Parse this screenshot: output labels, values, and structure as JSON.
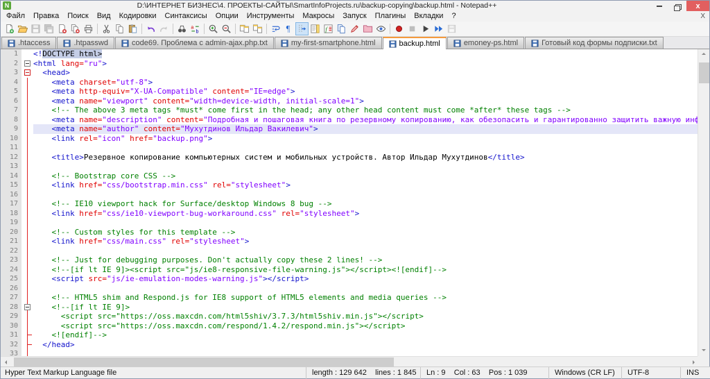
{
  "window": {
    "title": "D:\\ИНТЕРНЕТ БИЗНЕС\\4. ПРОЕКТЫ-САЙТЫ\\SmartInfoProjects.ru\\backup-copying\\backup.html - Notepad++",
    "app_icon": "N",
    "controls": {
      "minimize": "–",
      "restore": "",
      "close": "x"
    },
    "accent_close_color": "#e25f5f",
    "active_tab_accent": "#f59a3d"
  },
  "menu": {
    "items": [
      {
        "id": "file",
        "label": "Файл"
      },
      {
        "id": "edit",
        "label": "Правка"
      },
      {
        "id": "search",
        "label": "Поиск"
      },
      {
        "id": "view",
        "label": "Вид"
      },
      {
        "id": "encoding",
        "label": "Кодировки"
      },
      {
        "id": "language",
        "label": "Синтаксисы"
      },
      {
        "id": "settings",
        "label": "Опции"
      },
      {
        "id": "tools",
        "label": "Инструменты"
      },
      {
        "id": "macro",
        "label": "Макросы"
      },
      {
        "id": "run",
        "label": "Запуск"
      },
      {
        "id": "plugins",
        "label": "Плагины"
      },
      {
        "id": "tabs",
        "label": "Вкладки"
      },
      {
        "id": "help",
        "label": "?"
      }
    ],
    "close_label": "X"
  },
  "toolbar": {
    "items": [
      {
        "id": "new-file"
      },
      {
        "id": "open-file"
      },
      {
        "id": "save-file",
        "disabled": true
      },
      {
        "id": "save-all",
        "disabled": true
      },
      {
        "id": "close-file"
      },
      {
        "id": "close-all"
      },
      {
        "id": "print"
      },
      {
        "sep": true
      },
      {
        "id": "cut"
      },
      {
        "id": "copy"
      },
      {
        "id": "paste"
      },
      {
        "sep": true
      },
      {
        "id": "undo"
      },
      {
        "id": "redo",
        "disabled": true
      },
      {
        "sep": true
      },
      {
        "id": "find"
      },
      {
        "id": "replace"
      },
      {
        "sep": true
      },
      {
        "id": "zoom-in"
      },
      {
        "id": "zoom-out"
      },
      {
        "sep": true
      },
      {
        "id": "sync-vertical"
      },
      {
        "id": "sync-horizontal"
      },
      {
        "sep": true
      },
      {
        "id": "word-wrap"
      },
      {
        "id": "show-all-characters"
      },
      {
        "id": "show-indent-guide",
        "pressed": true
      },
      {
        "id": "doc-map"
      },
      {
        "id": "function-list"
      },
      {
        "id": "document-list"
      },
      {
        "id": "define-language"
      },
      {
        "id": "folder-as-workspace"
      },
      {
        "id": "monitoring"
      },
      {
        "sep": true
      },
      {
        "id": "macro-record"
      },
      {
        "id": "macro-stop",
        "disabled": true
      },
      {
        "id": "macro-play"
      },
      {
        "id": "macro-run-multiple"
      },
      {
        "id": "macro-save",
        "disabled": true
      }
    ]
  },
  "tabs": [
    {
      "label": ".htaccess",
      "active": false
    },
    {
      "label": ".htpasswd",
      "active": false
    },
    {
      "label": "code69. Проблема с admin-ajax.php.txt",
      "active": false
    },
    {
      "label": "my-first-smartphone.html",
      "active": false
    },
    {
      "label": "backup.html",
      "active": true
    },
    {
      "label": "emoney-ps.html",
      "active": false
    },
    {
      "label": "Готовый код формы подписки.txt",
      "active": false
    }
  ],
  "editor": {
    "current_line": 9,
    "lines": [
      {
        "n": 1,
        "fold": "",
        "seg": [
          [
            "t",
            "<!"
          ],
          [
            "d",
            "DOCTYPE html>"
          ]
        ]
      },
      {
        "n": 2,
        "fold": "box",
        "seg": [
          [
            "t",
            "<html "
          ],
          [
            "a",
            "lang="
          ],
          [
            "v",
            "\"ru\""
          ],
          [
            "t",
            ">"
          ]
        ]
      },
      {
        "n": 3,
        "fold": "box-active",
        "seg": [
          [
            "x",
            "  "
          ],
          [
            "t",
            "<head>"
          ]
        ]
      },
      {
        "n": 4,
        "fold": "line",
        "seg": [
          [
            "x",
            "    "
          ],
          [
            "t",
            "<meta "
          ],
          [
            "a",
            "charset="
          ],
          [
            "v",
            "\"utf-8\""
          ],
          [
            "t",
            ">"
          ]
        ]
      },
      {
        "n": 5,
        "fold": "line",
        "seg": [
          [
            "x",
            "    "
          ],
          [
            "t",
            "<meta "
          ],
          [
            "a",
            "http-equiv="
          ],
          [
            "v",
            "\"X-UA-Compatible\""
          ],
          [
            "x",
            " "
          ],
          [
            "a",
            "content="
          ],
          [
            "v",
            "\"IE=edge\""
          ],
          [
            "t",
            ">"
          ]
        ]
      },
      {
        "n": 6,
        "fold": "line",
        "seg": [
          [
            "x",
            "    "
          ],
          [
            "t",
            "<meta "
          ],
          [
            "a",
            "name="
          ],
          [
            "v",
            "\"viewport\""
          ],
          [
            "x",
            " "
          ],
          [
            "a",
            "content="
          ],
          [
            "v",
            "\"width=device-width, initial-scale=1\""
          ],
          [
            "t",
            ">"
          ]
        ]
      },
      {
        "n": 7,
        "fold": "line",
        "seg": [
          [
            "x",
            "    "
          ],
          [
            "c",
            "<!-- The above 3 meta tags *must* come first in the head; any other head content must come *after* these tags -->"
          ]
        ]
      },
      {
        "n": 8,
        "fold": "line",
        "seg": [
          [
            "x",
            "    "
          ],
          [
            "t",
            "<meta "
          ],
          [
            "a",
            "name="
          ],
          [
            "v",
            "\"description\""
          ],
          [
            "x",
            " "
          ],
          [
            "a",
            "content="
          ],
          [
            "v",
            "\"Подробная и пошаговая книга по резервному копированию, как обезопасить и гарантированно защитить важную информацию от внез"
          ]
        ]
      },
      {
        "n": 9,
        "fold": "line",
        "seg": [
          [
            "x",
            "    "
          ],
          [
            "t",
            "<meta "
          ],
          [
            "a",
            "name="
          ],
          [
            "v",
            "\"author\""
          ],
          [
            "x",
            " "
          ],
          [
            "a",
            "content="
          ],
          [
            "v",
            "\"Мухутдинов Ильдар Вакилевич\""
          ],
          [
            "t",
            ">"
          ]
        ]
      },
      {
        "n": 10,
        "fold": "line",
        "seg": [
          [
            "x",
            "    "
          ],
          [
            "t",
            "<link "
          ],
          [
            "a",
            "rel="
          ],
          [
            "v",
            "\"icon\""
          ],
          [
            "x",
            " "
          ],
          [
            "a",
            "href="
          ],
          [
            "v",
            "\"backup.png\""
          ],
          [
            "t",
            ">"
          ]
        ]
      },
      {
        "n": 11,
        "fold": "line",
        "seg": []
      },
      {
        "n": 12,
        "fold": "line",
        "seg": [
          [
            "x",
            "    "
          ],
          [
            "t",
            "<title>"
          ],
          [
            "x",
            "Резервное копирование компьютерных систем и мобильных устройств. Автор Ильдар Мухутдинов"
          ],
          [
            "t",
            "</title>"
          ]
        ]
      },
      {
        "n": 13,
        "fold": "line",
        "seg": []
      },
      {
        "n": 14,
        "fold": "line",
        "seg": [
          [
            "x",
            "    "
          ],
          [
            "c",
            "<!-- Bootstrap core CSS -->"
          ]
        ]
      },
      {
        "n": 15,
        "fold": "line",
        "seg": [
          [
            "x",
            "    "
          ],
          [
            "t",
            "<link "
          ],
          [
            "a",
            "href="
          ],
          [
            "v",
            "\"css/bootstrap.min.css\""
          ],
          [
            "x",
            " "
          ],
          [
            "a",
            "rel="
          ],
          [
            "v",
            "\"stylesheet\""
          ],
          [
            "t",
            ">"
          ]
        ]
      },
      {
        "n": 16,
        "fold": "line",
        "seg": []
      },
      {
        "n": 17,
        "fold": "line",
        "seg": [
          [
            "x",
            "    "
          ],
          [
            "c",
            "<!-- IE10 viewport hack for Surface/desktop Windows 8 bug -->"
          ]
        ]
      },
      {
        "n": 18,
        "fold": "line",
        "seg": [
          [
            "x",
            "    "
          ],
          [
            "t",
            "<link "
          ],
          [
            "a",
            "href="
          ],
          [
            "v",
            "\"css/ie10-viewport-bug-workaround.css\""
          ],
          [
            "x",
            " "
          ],
          [
            "a",
            "rel="
          ],
          [
            "v",
            "\"stylesheet\""
          ],
          [
            "t",
            ">"
          ]
        ]
      },
      {
        "n": 19,
        "fold": "line",
        "seg": []
      },
      {
        "n": 20,
        "fold": "line",
        "seg": [
          [
            "x",
            "    "
          ],
          [
            "c",
            "<!-- Custom styles for this template -->"
          ]
        ]
      },
      {
        "n": 21,
        "fold": "line",
        "seg": [
          [
            "x",
            "    "
          ],
          [
            "t",
            "<link "
          ],
          [
            "a",
            "href="
          ],
          [
            "v",
            "\"css/main.css\""
          ],
          [
            "x",
            " "
          ],
          [
            "a",
            "rel="
          ],
          [
            "v",
            "\"stylesheet\""
          ],
          [
            "t",
            ">"
          ]
        ]
      },
      {
        "n": 22,
        "fold": "line",
        "seg": []
      },
      {
        "n": 23,
        "fold": "line",
        "seg": [
          [
            "x",
            "    "
          ],
          [
            "c",
            "<!-- Just for debugging purposes. Don't actually copy these 2 lines! -->"
          ]
        ]
      },
      {
        "n": 24,
        "fold": "line",
        "seg": [
          [
            "x",
            "    "
          ],
          [
            "c",
            "<!--[if lt IE 9]><script src=\"js/ie8-responsive-file-warning.js\"></script><![endif]-->"
          ]
        ]
      },
      {
        "n": 25,
        "fold": "line",
        "seg": [
          [
            "x",
            "    "
          ],
          [
            "t",
            "<script "
          ],
          [
            "a",
            "src="
          ],
          [
            "v",
            "\"js/ie-emulation-modes-warning.js\""
          ],
          [
            "t",
            "></script>"
          ]
        ]
      },
      {
        "n": 26,
        "fold": "line",
        "seg": []
      },
      {
        "n": 27,
        "fold": "line",
        "seg": [
          [
            "x",
            "    "
          ],
          [
            "c",
            "<!-- HTML5 shim and Respond.js for IE8 support of HTML5 elements and media queries -->"
          ]
        ]
      },
      {
        "n": 28,
        "fold": "box-line",
        "seg": [
          [
            "x",
            "    "
          ],
          [
            "c",
            "<!--[if lt IE 9]>"
          ]
        ]
      },
      {
        "n": 29,
        "fold": "line",
        "seg": [
          [
            "x",
            "      "
          ],
          [
            "c",
            "<script src=\"https://oss.maxcdn.com/html5shiv/3.7.3/html5shiv.min.js\"></script>"
          ]
        ]
      },
      {
        "n": 30,
        "fold": "line",
        "seg": [
          [
            "x",
            "      "
          ],
          [
            "c",
            "<script src=\"https://oss.maxcdn.com/respond/1.4.2/respond.min.js\"></script>"
          ]
        ]
      },
      {
        "n": 31,
        "fold": "line-tick",
        "seg": [
          [
            "x",
            "    "
          ],
          [
            "c",
            "<![endif]-->"
          ]
        ]
      },
      {
        "n": 32,
        "fold": "line-tick",
        "seg": [
          [
            "x",
            "  "
          ],
          [
            "t",
            "</head>"
          ]
        ]
      },
      {
        "n": 33,
        "fold": "line",
        "seg": []
      }
    ]
  },
  "statusbar": {
    "doc_type": "Hyper Text Markup Language file",
    "length_info": "length : 129 642    lines : 1 845",
    "position_info": "Ln : 9    Col : 63    Pos : 1 039",
    "eol": "Windows (CR LF)",
    "encoding": "UTF-8",
    "insert_mode": "INS"
  }
}
